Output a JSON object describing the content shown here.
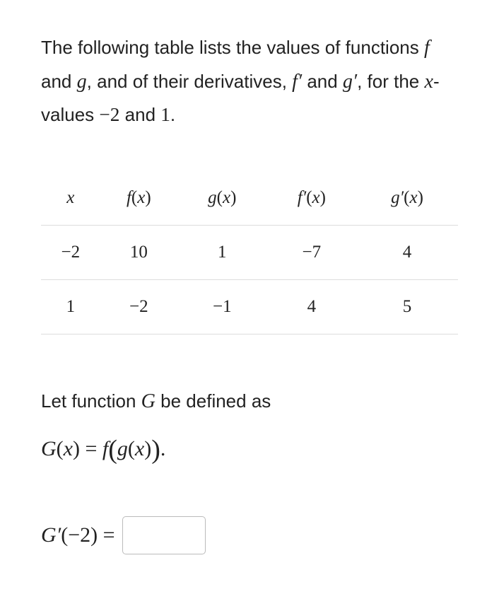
{
  "intro": {
    "part1": "The following table lists the values of functions ",
    "f": "f",
    "part2": " and ",
    "g": "g",
    "part3": ", and of their derivatives, ",
    "fprime": "f′",
    "part4": " and ",
    "gprime": "g′",
    "part5": ", for the ",
    "x": "x",
    "part6": "-values ",
    "neg2": "−2",
    "part7": " and ",
    "one": "1",
    "part8": "."
  },
  "table": {
    "headers": {
      "x": "x",
      "fx": "f(x)",
      "gx": "g(x)",
      "fpx": "f′(x)",
      "gpx": "g′(x)"
    },
    "rows": [
      {
        "x": "−2",
        "fx": "10",
        "gx": "1",
        "fpx": "−7",
        "gpx": "4"
      },
      {
        "x": "1",
        "fx": "−2",
        "gx": "−1",
        "fpx": "4",
        "gpx": "5"
      }
    ]
  },
  "define": {
    "part1": "Let function ",
    "G": "G",
    "part2": " be defined as",
    "formula_lhs": "G(x) = f",
    "formula_inner": "g(x)",
    "period": "."
  },
  "answer": {
    "lhs": "G′(−2) =",
    "value": ""
  }
}
